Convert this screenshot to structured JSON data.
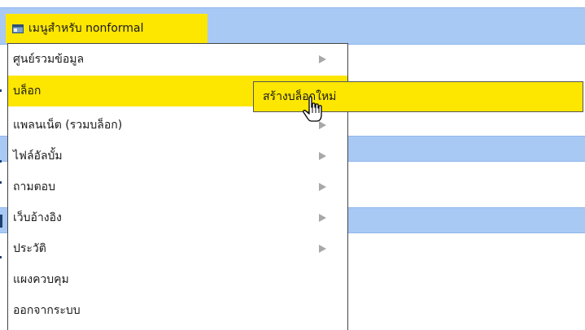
{
  "menu": {
    "header_label": "เมนูสำหรับ nonformal",
    "items": [
      {
        "label": "ศูนย์รวมข้อมูล",
        "has_submenu": true
      },
      {
        "label": "บล็อก",
        "has_submenu": false,
        "active": true
      },
      {
        "label": "แพลนเน็ต (รวมบล็อก)",
        "has_submenu": true
      },
      {
        "label": "ไฟล์อัลบั้ม",
        "has_submenu": true
      },
      {
        "label": "ถามตอบ",
        "has_submenu": true
      },
      {
        "label": "เว็บอ้างอิง",
        "has_submenu": true
      },
      {
        "label": "ประวัติ",
        "has_submenu": true
      },
      {
        "label": "แผงควบคุม",
        "has_submenu": false
      },
      {
        "label": "ออกจากระบบ",
        "has_submenu": false
      }
    ]
  },
  "submenu": {
    "items": [
      {
        "label": "สร้างบล็อกใหม่"
      }
    ]
  },
  "colors": {
    "highlight": "#fde600",
    "page_stripe": "#a9c9f5",
    "arrow": "#a8a8a8"
  },
  "icons": {
    "header": "window-icon",
    "submenu_arrow": "chevron-right-icon",
    "cursor": "hand-pointer-icon"
  }
}
